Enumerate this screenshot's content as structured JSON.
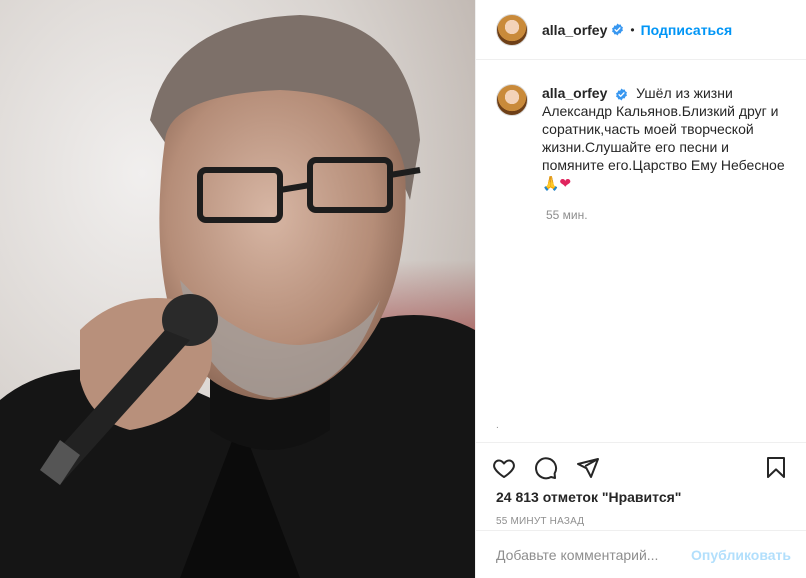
{
  "post": {
    "username": "alla_orfey",
    "follow_label": "Подписаться",
    "caption_line1": "Ушёл из жизни Александр Кальянов.Близкий друг и соратник,часть моей творческой жизни.Слушайте его песни и помяните его.Царство Ему Небесное",
    "caption_emoji": "🙏❤",
    "caption_time": "55 мин.",
    "likes": "24 813 отметок \"Нравится\"",
    "timestamp": "55 МИНУТ НАЗАД",
    "separator_dot": "•",
    "tiny_mark": "."
  },
  "comment": {
    "placeholder": "Добавьте комментарий...",
    "post_label": "Опубликовать"
  },
  "icons": [
    "heart-icon",
    "comment-icon",
    "share-icon",
    "bookmark-icon",
    "verified-icon"
  ],
  "colors": {
    "link": "#0095f6",
    "post_disabled": "#b2dffc",
    "verified": "#3897f0",
    "muted": "#8e8e8e"
  }
}
